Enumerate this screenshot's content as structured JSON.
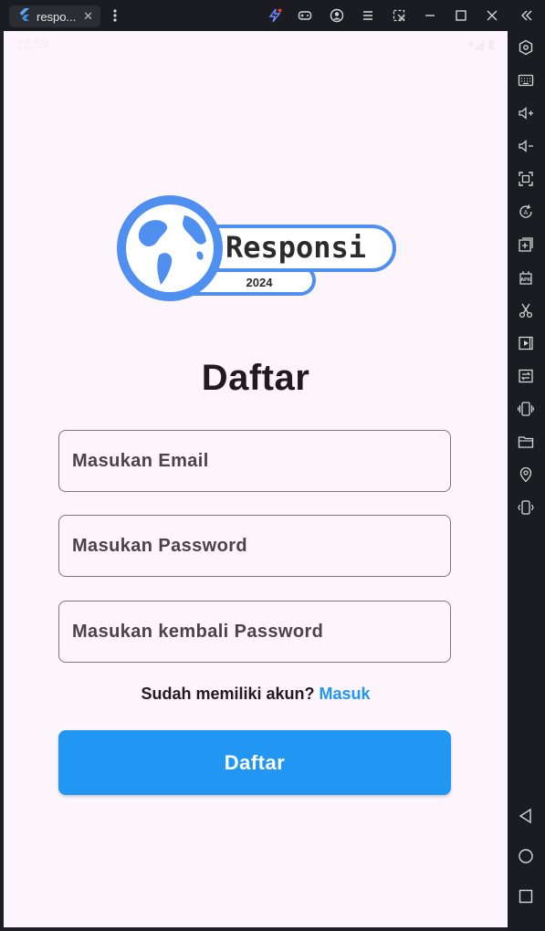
{
  "emulator": {
    "tab_title": "respo...",
    "tab_close": "✕",
    "toolbar_icons": [
      "bolt-icon",
      "gamepad-icon",
      "account-icon",
      "menu-icon",
      "screenshot-icon",
      "minimize-icon",
      "maximize-icon",
      "close-icon",
      "collapse-icon"
    ],
    "sidebar_icons": [
      "settings-icon",
      "keyboard-icon",
      "volume-up-icon",
      "volume-down-icon",
      "fullscreen-icon",
      "rotate-icon",
      "install-icon",
      "apk-icon",
      "scissors-icon",
      "record-icon",
      "sync-icon",
      "shake-icon",
      "folder-icon",
      "location-icon",
      "vibrate-icon",
      "back-icon",
      "home-icon",
      "recents-icon"
    ],
    "accent_color": "#2196f3"
  },
  "status_bar": {
    "time": "12:59",
    "right": "▾◢ ▮"
  },
  "logo": {
    "name": "Responsi",
    "year": "2024"
  },
  "form": {
    "title": "Daftar",
    "email_placeholder": "Masukan Email",
    "password_placeholder": "Masukan Password",
    "confirm_placeholder": "Masukan kembali Password",
    "have_account_text": "Sudah memiliki akun?",
    "login_link": "Masuk",
    "submit_label": "Daftar"
  }
}
